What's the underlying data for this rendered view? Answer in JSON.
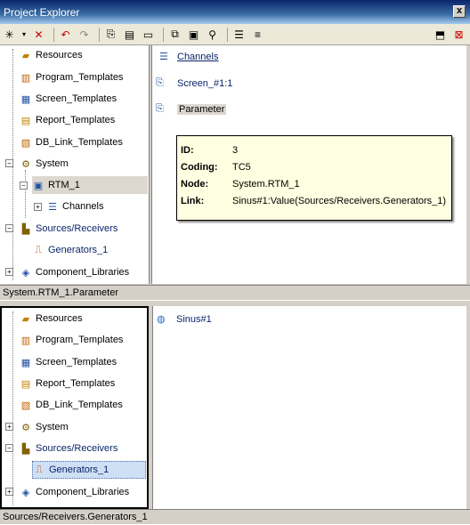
{
  "window": {
    "title": "Project Explorer",
    "close_glyph": "x"
  },
  "toolbar": {
    "icons": [
      "new-icon",
      "delete-icon",
      "undo-icon",
      "redo-icon",
      "copy-icon",
      "paste-icon",
      "properties-icon",
      "cut-icon",
      "save-icon",
      "search-icon",
      "tree-icon",
      "list-icon",
      "dock-icon",
      "close-icon"
    ]
  },
  "tree_top": {
    "items": [
      {
        "label": "Resources"
      },
      {
        "label": "Program_Templates"
      },
      {
        "label": "Screen_Templates"
      },
      {
        "label": "Report_Templates"
      },
      {
        "label": "DB_Link_Templates"
      },
      {
        "label": "System"
      },
      {
        "label": "RTM_1"
      },
      {
        "label": "Channels"
      },
      {
        "label": "Sources/Receivers"
      },
      {
        "label": "Generators_1"
      },
      {
        "label": "Component_Libraries"
      }
    ]
  },
  "detail_top": {
    "items": [
      {
        "label": "Channels"
      },
      {
        "label": "Screen_#1:1"
      },
      {
        "label": "Parameter"
      }
    ]
  },
  "tooltip": {
    "rows": [
      {
        "key": "ID:",
        "value": "3"
      },
      {
        "key": "Coding:",
        "value": "TC5"
      },
      {
        "key": "Node:",
        "value": "System.RTM_1"
      },
      {
        "key": "Link:",
        "value": "Sinus#1:Value(Sources/Receivers.Generators_1)"
      }
    ]
  },
  "status_top": {
    "text": "System.RTM_1.Parameter"
  },
  "tree_bottom": {
    "items": [
      {
        "label": "Resources"
      },
      {
        "label": "Program_Templates"
      },
      {
        "label": "Screen_Templates"
      },
      {
        "label": "Report_Templates"
      },
      {
        "label": "DB_Link_Templates"
      },
      {
        "label": "System"
      },
      {
        "label": "Sources/Receivers"
      },
      {
        "label": "Generators_1"
      },
      {
        "label": "Component_Libraries"
      }
    ]
  },
  "detail_bottom": {
    "items": [
      {
        "label": "Sinus#1"
      }
    ]
  },
  "status_bottom": {
    "text": "Sources/Receivers.Generators_1"
  },
  "colors": {
    "title_bar": "#0a246a",
    "tooltip_bg": "#ffffe1",
    "link": "#0a246a"
  }
}
